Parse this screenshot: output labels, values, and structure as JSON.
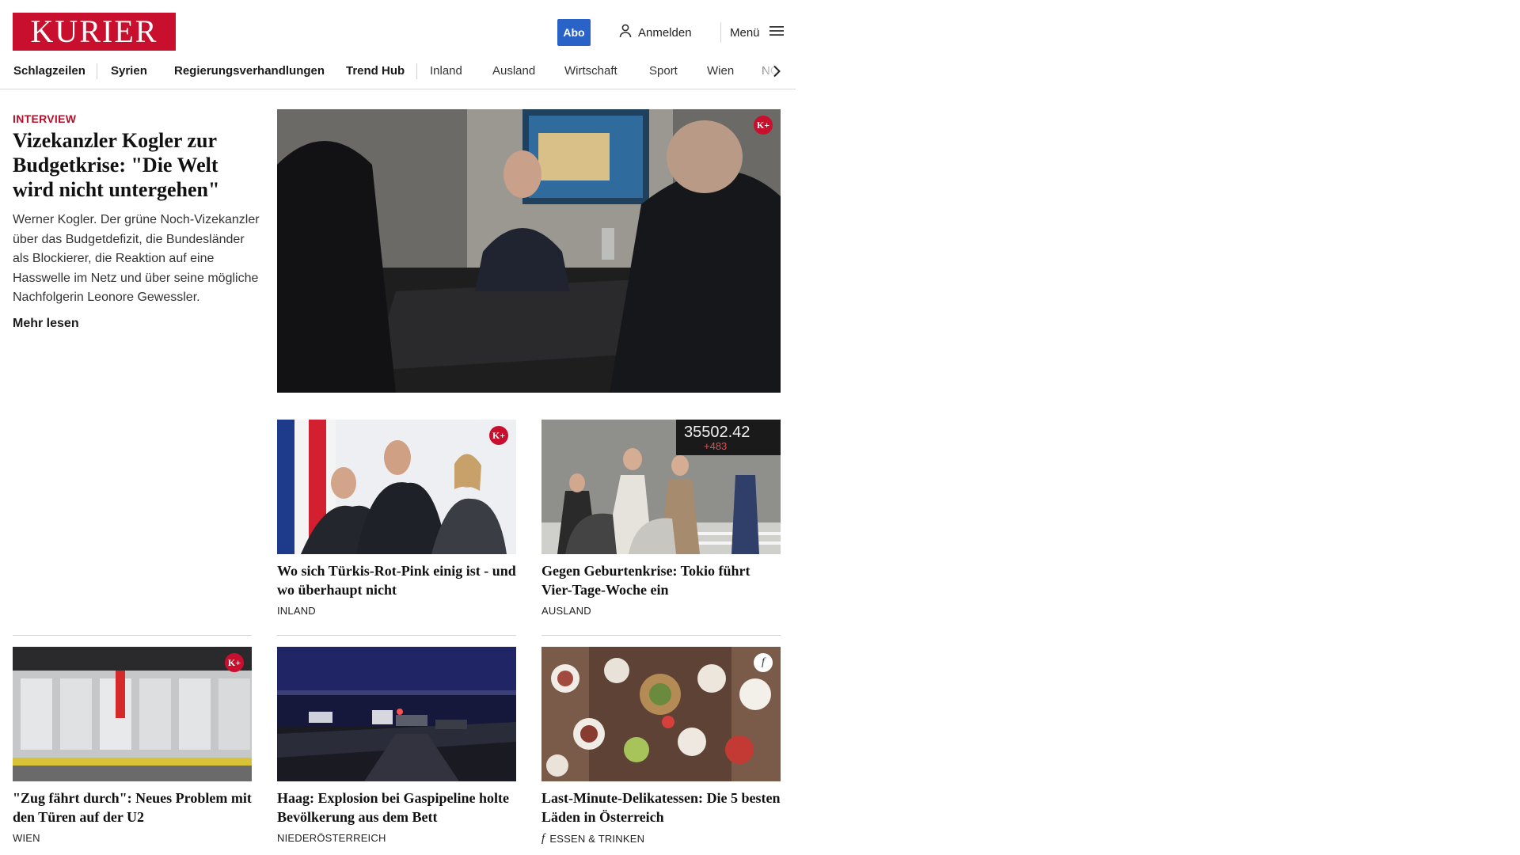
{
  "header": {
    "logo_text": "KURIER",
    "abo_label": "Abo",
    "login_label": "Anmelden",
    "menu_label": "Menü",
    "brand_color": "#c8102e",
    "abo_color": "#2a63c8"
  },
  "nav": {
    "items": [
      {
        "label": "Schlagzeilen"
      },
      {
        "label": "Syrien"
      },
      {
        "label": "Regierungsverhandlungen"
      },
      {
        "label": "Trend Hub"
      },
      {
        "label": "Inland"
      },
      {
        "label": "Ausland"
      },
      {
        "label": "Wirtschaft"
      },
      {
        "label": "Sport"
      },
      {
        "label": "Wien"
      },
      {
        "label": "NÖ"
      }
    ]
  },
  "lead": {
    "kicker": "INTERVIEW",
    "title": "Vizekanzler Kogler zur Budgetkrise: \"Die Welt wird nicht untergehen\"",
    "teaser": "Werner Kogler. Der grüne Noch-Vizekanzler über das Budgetdefizit, die Bundesländer als Blockierer, die Reaktion auf eine Hasswelle im Netz und über seine mögliche Nachfolgerin Leonore Gewessler.",
    "more_label": "Mehr lesen",
    "badge": "K+"
  },
  "cards": [
    {
      "title": "Wo sich Türkis-Rot-Pink einig ist - und wo überhaupt nicht",
      "category": "INLAND",
      "badge": "K+"
    },
    {
      "title": "Gegen Geburtenkrise: Tokio führt Vier-Tage-Woche ein",
      "category": "AUSLAND",
      "image_text": "35502.42 +483"
    },
    {
      "title": "\"Zug fährt durch\": Neues Problem mit den Türen auf der U2",
      "category": "WIEN",
      "badge": "K+"
    },
    {
      "title": "Haag: Explosion bei Gaspipeline holte Bevölkerung aus dem Bett",
      "category": "NIEDERÖSTERREICH"
    },
    {
      "title": "Last-Minute-Delikatessen: Die 5 besten Läden in Österreich",
      "category": "ESSEN & TRINKEN",
      "badge": "f",
      "category_icon": "f"
    }
  ]
}
